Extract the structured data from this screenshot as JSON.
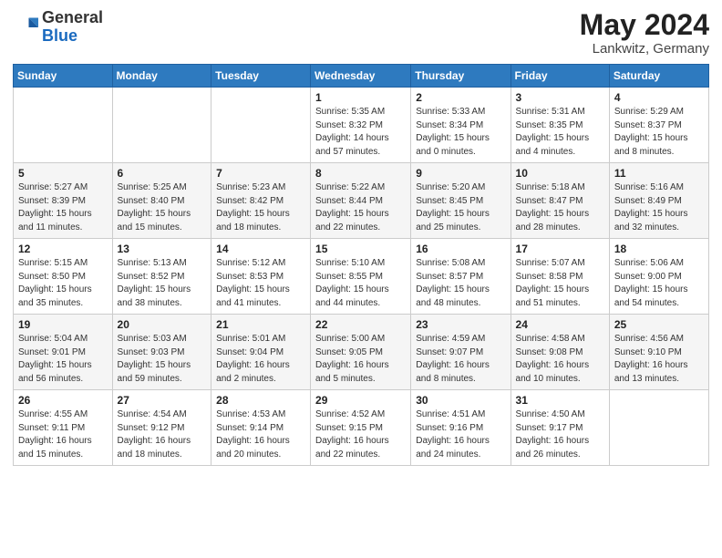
{
  "header": {
    "logo_general": "General",
    "logo_blue": "Blue",
    "month_year": "May 2024",
    "location": "Lankwitz, Germany"
  },
  "weekdays": [
    "Sunday",
    "Monday",
    "Tuesday",
    "Wednesday",
    "Thursday",
    "Friday",
    "Saturday"
  ],
  "weeks": [
    [
      {
        "day": "",
        "info": ""
      },
      {
        "day": "",
        "info": ""
      },
      {
        "day": "",
        "info": ""
      },
      {
        "day": "1",
        "info": "Sunrise: 5:35 AM\nSunset: 8:32 PM\nDaylight: 14 hours\nand 57 minutes."
      },
      {
        "day": "2",
        "info": "Sunrise: 5:33 AM\nSunset: 8:34 PM\nDaylight: 15 hours\nand 0 minutes."
      },
      {
        "day": "3",
        "info": "Sunrise: 5:31 AM\nSunset: 8:35 PM\nDaylight: 15 hours\nand 4 minutes."
      },
      {
        "day": "4",
        "info": "Sunrise: 5:29 AM\nSunset: 8:37 PM\nDaylight: 15 hours\nand 8 minutes."
      }
    ],
    [
      {
        "day": "5",
        "info": "Sunrise: 5:27 AM\nSunset: 8:39 PM\nDaylight: 15 hours\nand 11 minutes."
      },
      {
        "day": "6",
        "info": "Sunrise: 5:25 AM\nSunset: 8:40 PM\nDaylight: 15 hours\nand 15 minutes."
      },
      {
        "day": "7",
        "info": "Sunrise: 5:23 AM\nSunset: 8:42 PM\nDaylight: 15 hours\nand 18 minutes."
      },
      {
        "day": "8",
        "info": "Sunrise: 5:22 AM\nSunset: 8:44 PM\nDaylight: 15 hours\nand 22 minutes."
      },
      {
        "day": "9",
        "info": "Sunrise: 5:20 AM\nSunset: 8:45 PM\nDaylight: 15 hours\nand 25 minutes."
      },
      {
        "day": "10",
        "info": "Sunrise: 5:18 AM\nSunset: 8:47 PM\nDaylight: 15 hours\nand 28 minutes."
      },
      {
        "day": "11",
        "info": "Sunrise: 5:16 AM\nSunset: 8:49 PM\nDaylight: 15 hours\nand 32 minutes."
      }
    ],
    [
      {
        "day": "12",
        "info": "Sunrise: 5:15 AM\nSunset: 8:50 PM\nDaylight: 15 hours\nand 35 minutes."
      },
      {
        "day": "13",
        "info": "Sunrise: 5:13 AM\nSunset: 8:52 PM\nDaylight: 15 hours\nand 38 minutes."
      },
      {
        "day": "14",
        "info": "Sunrise: 5:12 AM\nSunset: 8:53 PM\nDaylight: 15 hours\nand 41 minutes."
      },
      {
        "day": "15",
        "info": "Sunrise: 5:10 AM\nSunset: 8:55 PM\nDaylight: 15 hours\nand 44 minutes."
      },
      {
        "day": "16",
        "info": "Sunrise: 5:08 AM\nSunset: 8:57 PM\nDaylight: 15 hours\nand 48 minutes."
      },
      {
        "day": "17",
        "info": "Sunrise: 5:07 AM\nSunset: 8:58 PM\nDaylight: 15 hours\nand 51 minutes."
      },
      {
        "day": "18",
        "info": "Sunrise: 5:06 AM\nSunset: 9:00 PM\nDaylight: 15 hours\nand 54 minutes."
      }
    ],
    [
      {
        "day": "19",
        "info": "Sunrise: 5:04 AM\nSunset: 9:01 PM\nDaylight: 15 hours\nand 56 minutes."
      },
      {
        "day": "20",
        "info": "Sunrise: 5:03 AM\nSunset: 9:03 PM\nDaylight: 15 hours\nand 59 minutes."
      },
      {
        "day": "21",
        "info": "Sunrise: 5:01 AM\nSunset: 9:04 PM\nDaylight: 16 hours\nand 2 minutes."
      },
      {
        "day": "22",
        "info": "Sunrise: 5:00 AM\nSunset: 9:05 PM\nDaylight: 16 hours\nand 5 minutes."
      },
      {
        "day": "23",
        "info": "Sunrise: 4:59 AM\nSunset: 9:07 PM\nDaylight: 16 hours\nand 8 minutes."
      },
      {
        "day": "24",
        "info": "Sunrise: 4:58 AM\nSunset: 9:08 PM\nDaylight: 16 hours\nand 10 minutes."
      },
      {
        "day": "25",
        "info": "Sunrise: 4:56 AM\nSunset: 9:10 PM\nDaylight: 16 hours\nand 13 minutes."
      }
    ],
    [
      {
        "day": "26",
        "info": "Sunrise: 4:55 AM\nSunset: 9:11 PM\nDaylight: 16 hours\nand 15 minutes."
      },
      {
        "day": "27",
        "info": "Sunrise: 4:54 AM\nSunset: 9:12 PM\nDaylight: 16 hours\nand 18 minutes."
      },
      {
        "day": "28",
        "info": "Sunrise: 4:53 AM\nSunset: 9:14 PM\nDaylight: 16 hours\nand 20 minutes."
      },
      {
        "day": "29",
        "info": "Sunrise: 4:52 AM\nSunset: 9:15 PM\nDaylight: 16 hours\nand 22 minutes."
      },
      {
        "day": "30",
        "info": "Sunrise: 4:51 AM\nSunset: 9:16 PM\nDaylight: 16 hours\nand 24 minutes."
      },
      {
        "day": "31",
        "info": "Sunrise: 4:50 AM\nSunset: 9:17 PM\nDaylight: 16 hours\nand 26 minutes."
      },
      {
        "day": "",
        "info": ""
      }
    ]
  ]
}
